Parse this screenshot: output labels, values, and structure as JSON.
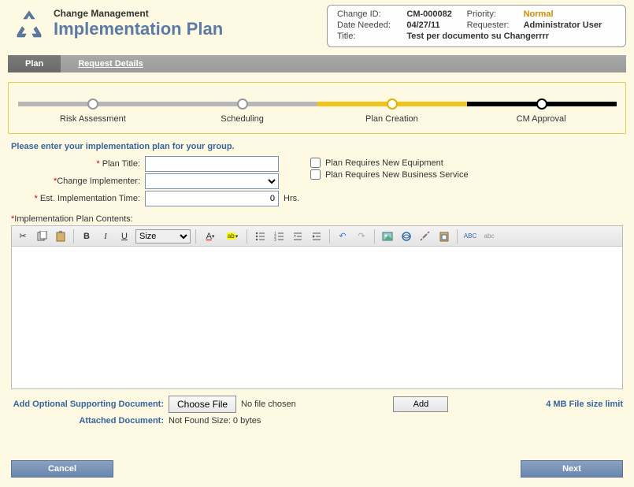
{
  "header": {
    "module": "Change Management",
    "page": "Implementation Plan"
  },
  "info": {
    "change_id_lbl": "Change ID:",
    "change_id": "CM-000082",
    "priority_lbl": "Priority:",
    "priority": "Normal",
    "date_needed_lbl": "Date Needed:",
    "date_needed": "04/27/11",
    "requester_lbl": "Requester:",
    "requester": "Administrator User",
    "title_lbl": "Title:",
    "title": "Test per documento su Changerrrr"
  },
  "tabs": {
    "plan": "Plan",
    "request_details": "Request Details"
  },
  "steps": {
    "risk": "Risk Assessment",
    "scheduling": "Scheduling",
    "plan_creation": "Plan Creation",
    "cm_approval": "CM Approval"
  },
  "instruction": "Please enter your implementation plan for your group.",
  "form": {
    "plan_title_lbl": "Plan Title:",
    "plan_title_val": "",
    "change_impl_lbl": "Change Implementer:",
    "est_time_lbl": "Est. Implementation Time:",
    "est_time_val": "0",
    "hrs": "Hrs.",
    "req_equip": "Plan Requires New Equipment",
    "req_svc": "Plan Requires New Business Service",
    "contents_lbl": "Implementation Plan Contents:"
  },
  "toolbar": {
    "size_label": "Size"
  },
  "attach": {
    "add_doc_lbl": "Add Optional Supporting Document:",
    "choose_file": "Choose File",
    "no_file": "No file chosen",
    "add": "Add",
    "limit": "4 MB File size limit",
    "attached_doc_lbl": "Attached Document:",
    "attached_status": "Not Found Size: 0 bytes"
  },
  "buttons": {
    "cancel": "Cancel",
    "next": "Next"
  }
}
